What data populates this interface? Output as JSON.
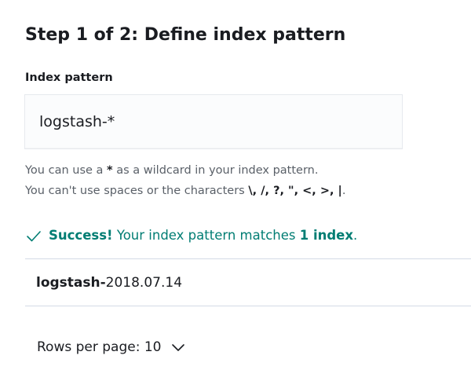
{
  "step": {
    "title": "Step 1 of 2: Define index pattern"
  },
  "index_pattern": {
    "label": "Index pattern",
    "value": "logstash-*"
  },
  "help": {
    "line1_prefix": "You can use a ",
    "line1_wildcard": "*",
    "line1_suffix": " as a wildcard in your index pattern.",
    "line2_prefix": "You can't use spaces or the characters ",
    "line2_chars": "\\, /, ?, \", <, >, |",
    "line2_suffix": "."
  },
  "status": {
    "icon": "check-icon",
    "success_label": "Success!",
    "message": "Your index pattern matches",
    "count_label": "1 index",
    "end": ".",
    "color": "#017d73"
  },
  "matches": [
    {
      "match_part": "logstash-",
      "rest": "2018.07.14"
    }
  ],
  "pagination": {
    "rows_per_page_label": "Rows per page:",
    "rows_per_page_value": "10",
    "icon": "chevron-down-icon"
  }
}
